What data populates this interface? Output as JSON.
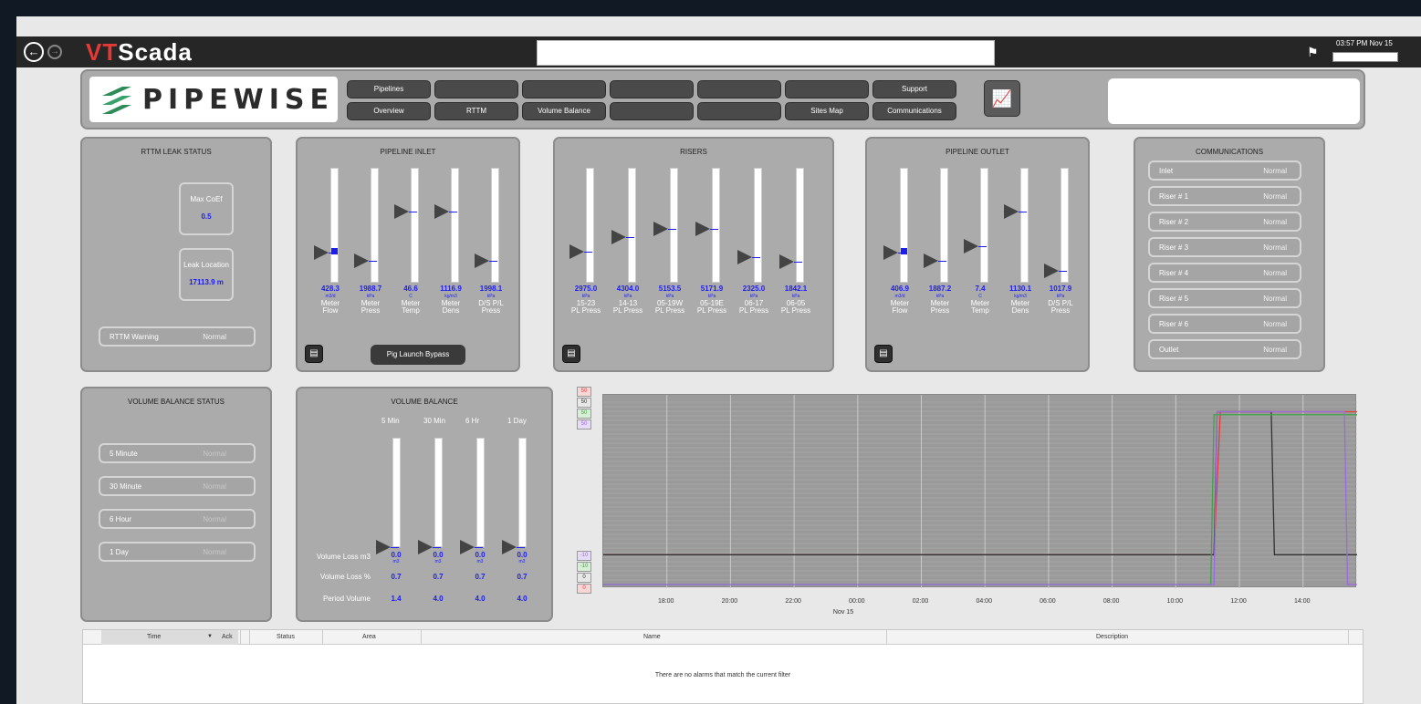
{
  "app": {
    "name_red": "VT",
    "name_white": "Scada",
    "clock": "03:57 PM  Nov 15"
  },
  "brand": {
    "name": "PIPEWISE"
  },
  "nav": {
    "row1": [
      "Pipelines",
      "",
      "",
      "",
      "",
      "",
      "Support"
    ],
    "row2": [
      "Overview",
      "RTTM",
      "Volume Balance",
      "",
      "",
      "Sites Map",
      "Communications"
    ]
  },
  "rttm": {
    "title": "RTTM LEAK STATUS",
    "max_coef_label": "Max CoEf",
    "max_coef_value": "0.5",
    "leak_location_label": "Leak Location",
    "leak_location_value": "17113.9 m",
    "warning_label": "RTTM Warning",
    "warning_status": "Normal"
  },
  "inlet": {
    "title": "PIPELINE INLET",
    "pig_button": "Pig Launch Bypass",
    "gauges": [
      {
        "value": "428.3",
        "unit": "m3/d",
        "label": "Meter\nFlow",
        "fill": 0.06,
        "level": 0.26
      },
      {
        "value": "1988.7",
        "unit": "kPa",
        "label": "Meter\nPress",
        "fill": 0,
        "level": 0.19
      },
      {
        "value": "46.6",
        "unit": "C",
        "label": "Meter\nTemp",
        "fill": 0,
        "level": 0.62
      },
      {
        "value": "1116.9",
        "unit": "kg/m3",
        "label": "Meter\nDens",
        "fill": 0,
        "level": 0.62
      },
      {
        "value": "1998.1",
        "unit": "kPa",
        "label": "D/S P/L\nPress",
        "fill": 0,
        "level": 0.19
      }
    ]
  },
  "risers": {
    "title": "RISERS",
    "gauges": [
      {
        "value": "2975.0",
        "unit": "kPa",
        "label": "15-23\nPL Press",
        "level": 0.27
      },
      {
        "value": "4304.0",
        "unit": "kPa",
        "label": "14-13\nPL Press",
        "level": 0.4
      },
      {
        "value": "5153.5",
        "unit": "kPa",
        "label": "05-19W\nPL Press",
        "level": 0.47
      },
      {
        "value": "5171.9",
        "unit": "kPa",
        "label": "05-19E\nPL Press",
        "level": 0.47
      },
      {
        "value": "2325.0",
        "unit": "kPa",
        "label": "06-17\nPL Press",
        "level": 0.22
      },
      {
        "value": "1842.1",
        "unit": "kPa",
        "label": "06-05\nPL Press",
        "level": 0.18
      }
    ]
  },
  "outlet": {
    "title": "PIPELINE OUTLET",
    "gauges": [
      {
        "value": "406.9",
        "unit": "m3/d",
        "label": "Meter\nFlow",
        "fill": 0.06,
        "level": 0.26
      },
      {
        "value": "1887.2",
        "unit": "kPa",
        "label": "Meter\nPress",
        "fill": 0,
        "level": 0.19
      },
      {
        "value": "7.4",
        "unit": "C",
        "label": "Meter\nTemp",
        "fill": 0,
        "level": 0.32
      },
      {
        "value": "1130.1",
        "unit": "kg/m3",
        "label": "Meter\nDens",
        "fill": 0,
        "level": 0.62
      },
      {
        "value": "1017.9",
        "unit": "kPa",
        "label": "D/S P/L\nPress",
        "fill": 0,
        "level": 0.1
      }
    ]
  },
  "comms": {
    "title": "COMMUNICATIONS",
    "items": [
      {
        "name": "Inlet",
        "status": "Normal"
      },
      {
        "name": "Riser # 1",
        "status": "Normal"
      },
      {
        "name": "Riser # 2",
        "status": "Normal"
      },
      {
        "name": "Riser # 3",
        "status": "Normal"
      },
      {
        "name": "Riser # 4",
        "status": "Normal"
      },
      {
        "name": "Riser # 5",
        "status": "Normal"
      },
      {
        "name": "Riser # 6",
        "status": "Normal"
      },
      {
        "name": "Outlet",
        "status": "Normal"
      }
    ]
  },
  "vbstatus": {
    "title": "VOLUME BALANCE STATUS",
    "items": [
      {
        "name": "5 Minute",
        "status": "Normal"
      },
      {
        "name": "30 Minute",
        "status": "Normal"
      },
      {
        "name": "6 Hour",
        "status": "Normal"
      },
      {
        "name": "1 Day",
        "status": "Normal"
      }
    ]
  },
  "vb": {
    "title": "VOLUME BALANCE",
    "periods": [
      "5 Min",
      "30 Min",
      "6 Hr",
      "1 Day"
    ],
    "row_labels": [
      "Volume Loss m3",
      "Volume Loss %",
      "Period Volume"
    ],
    "loss_m3": [
      "0.0",
      "0.0",
      "0.0",
      "0.0"
    ],
    "unit": "m3",
    "loss_pct": [
      "0.7",
      "0.7",
      "0.7",
      "0.7"
    ],
    "period_volume": [
      "1.4",
      "4.0",
      "4.0",
      "4.0"
    ]
  },
  "chart_data": {
    "type": "line",
    "y_scale_tags_top": [
      "50",
      "50",
      "50",
      "50"
    ],
    "y_scale_tags_bottom": [
      "0",
      "0",
      "-10",
      "-10"
    ],
    "ylim": [
      -10,
      50
    ],
    "x_ticks": [
      "18:00",
      "20:00",
      "22:00",
      "00:00",
      "02:00",
      "04:00",
      "06:00",
      "08:00",
      "10:00",
      "12:00",
      "14:00"
    ],
    "x_sublabel": "Nov 15",
    "series": [
      {
        "color": "#e53935",
        "points": [
          [
            16.0,
            0
          ],
          [
            35.2,
            0
          ],
          [
            35.4,
            48
          ],
          [
            37.0,
            48
          ],
          [
            37.1,
            48
          ],
          [
            39.7,
            48
          ]
        ]
      },
      {
        "color": "#333333",
        "points": [
          [
            16.0,
            0
          ],
          [
            35.2,
            0
          ],
          [
            35.3,
            48
          ],
          [
            37.0,
            48
          ],
          [
            37.1,
            0
          ],
          [
            39.7,
            0
          ]
        ]
      },
      {
        "color": "#43a047",
        "points": [
          [
            16.0,
            -10
          ],
          [
            35.1,
            -10
          ],
          [
            35.2,
            47
          ],
          [
            39.7,
            47
          ]
        ]
      },
      {
        "color": "#9c6ae0",
        "points": [
          [
            16.0,
            -10
          ],
          [
            35.2,
            -10
          ],
          [
            35.3,
            48
          ],
          [
            39.3,
            48
          ],
          [
            39.4,
            -10
          ],
          [
            39.7,
            -10
          ]
        ]
      }
    ],
    "colors": {
      "red": "#e53935",
      "black": "#333333",
      "green": "#43a047",
      "purple": "#9c6ae0"
    }
  },
  "alarms": {
    "columns": [
      "Time",
      "Ack",
      "Status",
      "Area",
      "Name",
      "Description"
    ],
    "empty_message": "There are no alarms that match the current filter"
  }
}
